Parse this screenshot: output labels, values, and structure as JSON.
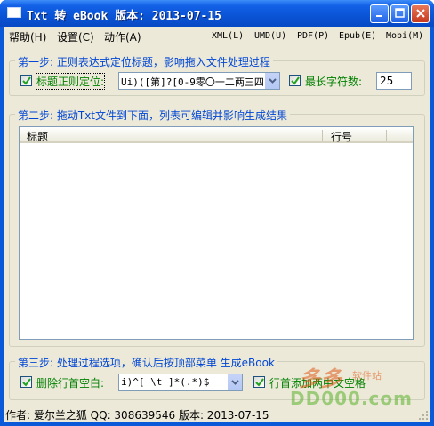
{
  "window": {
    "title": "Txt 转 eBook 版本: 2013-07-15",
    "minimize_label": "_",
    "maximize_label": "□",
    "close_label": "×"
  },
  "menu": {
    "help": "帮助(H)",
    "settings": "设置(C)",
    "action": "动作(A)",
    "xml": "XML(L)",
    "umd": "UMD(U)",
    "pdf": "PDF(P)",
    "epub": "Epub(E)",
    "mobi": "Mobi(M)"
  },
  "step1": {
    "legend": "第一步: 正则表达式定位标题，影响拖入文件处理过程",
    "regex_checkbox_label": "标题正则定位:",
    "regex_checked": true,
    "regex_value": "Ui)([第]?[0-9零〇一二两三四",
    "maxlen_checkbox_label": "最长字符数:",
    "maxlen_checked": true,
    "maxlen_value": "25"
  },
  "step2": {
    "legend": "第二步: 拖动Txt文件到下面，列表可编辑并影响生成结果",
    "columns": [
      "标题",
      "行号"
    ]
  },
  "step3": {
    "legend": "第三步: 处理过程选项，确认后按顶部菜单 生成eBook",
    "strip_checkbox_label": "删除行首空白:",
    "strip_checked": true,
    "strip_regex": "i)^[ \\t  ]*(.*)$",
    "indent_checkbox_label": "行首添加两中文空格",
    "indent_checked": true
  },
  "status": {
    "text": "作者: 爱尔兰之狐   QQ: 308639546   版本: 2013-07-15"
  },
  "watermark": {
    "title": "多多",
    "subtitle": "软件站",
    "url": "DD000.com"
  },
  "colors": {
    "titlebar": "#0a55d8",
    "face": "#ece9d8",
    "legend": "#0046d5",
    "label_green": "#008000"
  }
}
